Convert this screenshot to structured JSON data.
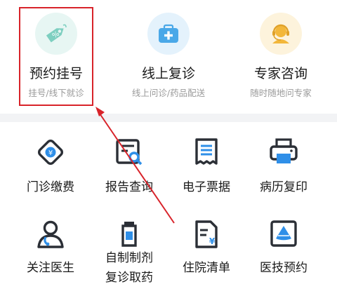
{
  "top_services": [
    {
      "title": "预约挂号",
      "subtitle": "挂号/线下就诊",
      "icon": "ticket-tag-icon",
      "color": "#6cc7b8",
      "bg": "#e7f6f3"
    },
    {
      "title": "线上复诊",
      "subtitle": "线上问诊/药品配送",
      "icon": "medical-kit-icon",
      "color": "#4aa8e8",
      "bg": "#e4f2fc"
    },
    {
      "title": "专家咨询",
      "subtitle": "随时随地问专家",
      "icon": "headset-doctor-icon",
      "color": "#f3b73a",
      "bg": "#fdf3dc"
    }
  ],
  "grid_row1": [
    {
      "label": "门诊缴费",
      "icon": "payment-diamond-icon"
    },
    {
      "label": "报告查询",
      "icon": "report-search-icon"
    },
    {
      "label": "电子票据",
      "icon": "e-receipt-icon"
    },
    {
      "label": "病历复印",
      "icon": "printer-icon"
    }
  ],
  "grid_row2": [
    {
      "label": "关注医生",
      "icon": "doctor-icon"
    },
    {
      "label_line1": "自制制剂",
      "label_line2": "复诊取药",
      "icon": "medicine-bottle-icon"
    },
    {
      "label": "住院清单",
      "icon": "hospital-bill-icon"
    },
    {
      "label": "医技预约",
      "icon": "ultrasound-icon"
    }
  ],
  "annotation": {
    "highlight_color": "#d8232a"
  }
}
